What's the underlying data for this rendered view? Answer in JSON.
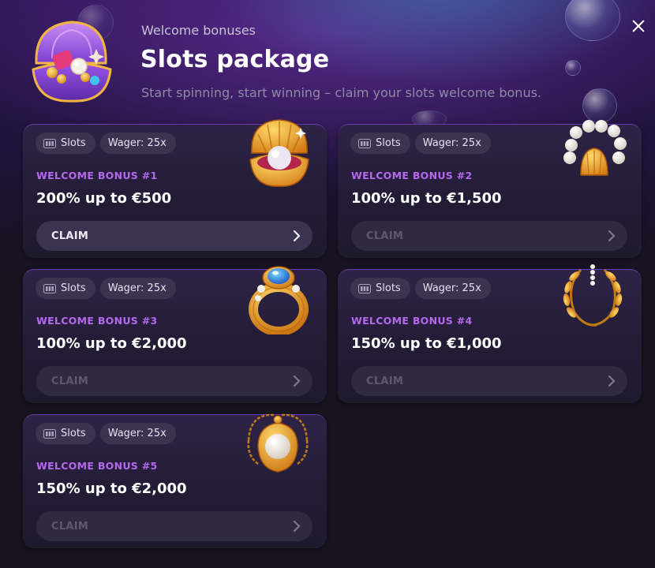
{
  "header": {
    "eyebrow": "Welcome bonuses",
    "title": "Slots package",
    "subtitle": "Start spinning, start winning – claim your slots welcome bonus."
  },
  "colors": {
    "accent_purple": "#b569f0",
    "card_bg": "#231c36",
    "button_bg": "#2f2a40",
    "tag_bg": "#3a3450"
  },
  "cards": [
    {
      "category": "Slots",
      "wager": "Wager: 25x",
      "label": "WELCOME BONUS #1",
      "amount": "200% up to €500",
      "claim": "CLAIM",
      "icon": "pearl-shell-icon",
      "claim_active": true
    },
    {
      "category": "Slots",
      "wager": "Wager: 25x",
      "label": "WELCOME BONUS #2",
      "amount": "100% up to €1,500",
      "claim": "CLAIM",
      "icon": "pearl-bracelet-icon",
      "claim_active": false
    },
    {
      "category": "Slots",
      "wager": "Wager: 25x",
      "label": "WELCOME BONUS #3",
      "amount": "100% up to €2,000",
      "claim": "CLAIM",
      "icon": "sapphire-ring-icon",
      "claim_active": false
    },
    {
      "category": "Slots",
      "wager": "Wager: 25x",
      "label": "WELCOME BONUS #4",
      "amount": "150% up to €1,000",
      "claim": "CLAIM",
      "icon": "laurel-wreath-icon",
      "claim_active": false
    },
    {
      "category": "Slots",
      "wager": "Wager: 25x",
      "label": "WELCOME BONUS #5",
      "amount": "150% up to €2,000",
      "claim": "CLAIM",
      "icon": "pearl-pendant-icon",
      "claim_active": false
    }
  ]
}
